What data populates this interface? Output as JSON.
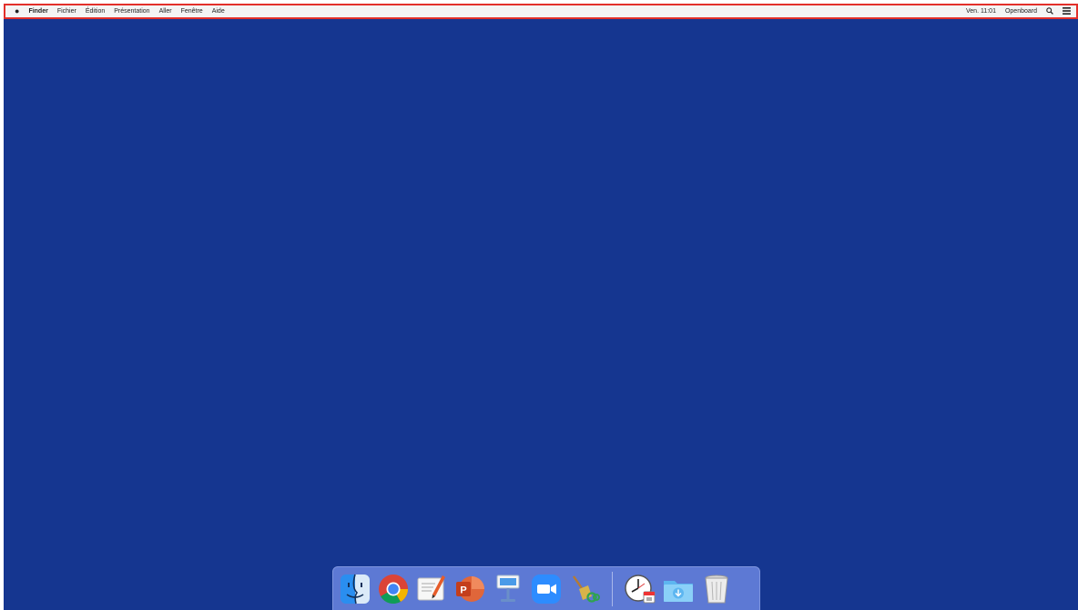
{
  "menubar": {
    "apple_symbol": "●",
    "app_name": "Finder",
    "menus": [
      "Fichier",
      "Édition",
      "Présentation",
      "Aller",
      "Fenêtre",
      "Aide"
    ],
    "status": {
      "clock": "Ven. 11:01",
      "user": "Openboard"
    }
  },
  "colors": {
    "desktop": "#153690",
    "menubar_border": "#e3302a",
    "dock": "#5d79d4"
  },
  "dock": {
    "apps": [
      {
        "icon": "finder-icon"
      },
      {
        "icon": "chrome-icon"
      },
      {
        "icon": "textedit-icon"
      },
      {
        "icon": "powerpoint-icon"
      },
      {
        "icon": "keynote-icon"
      },
      {
        "icon": "zoom-icon"
      },
      {
        "icon": "cleaner-broom-icon"
      }
    ],
    "others": [
      {
        "icon": "clock-calendar-icon"
      },
      {
        "icon": "downloads-folder-icon"
      },
      {
        "icon": "trash-icon"
      }
    ],
    "powerpoint_letter": "P"
  }
}
